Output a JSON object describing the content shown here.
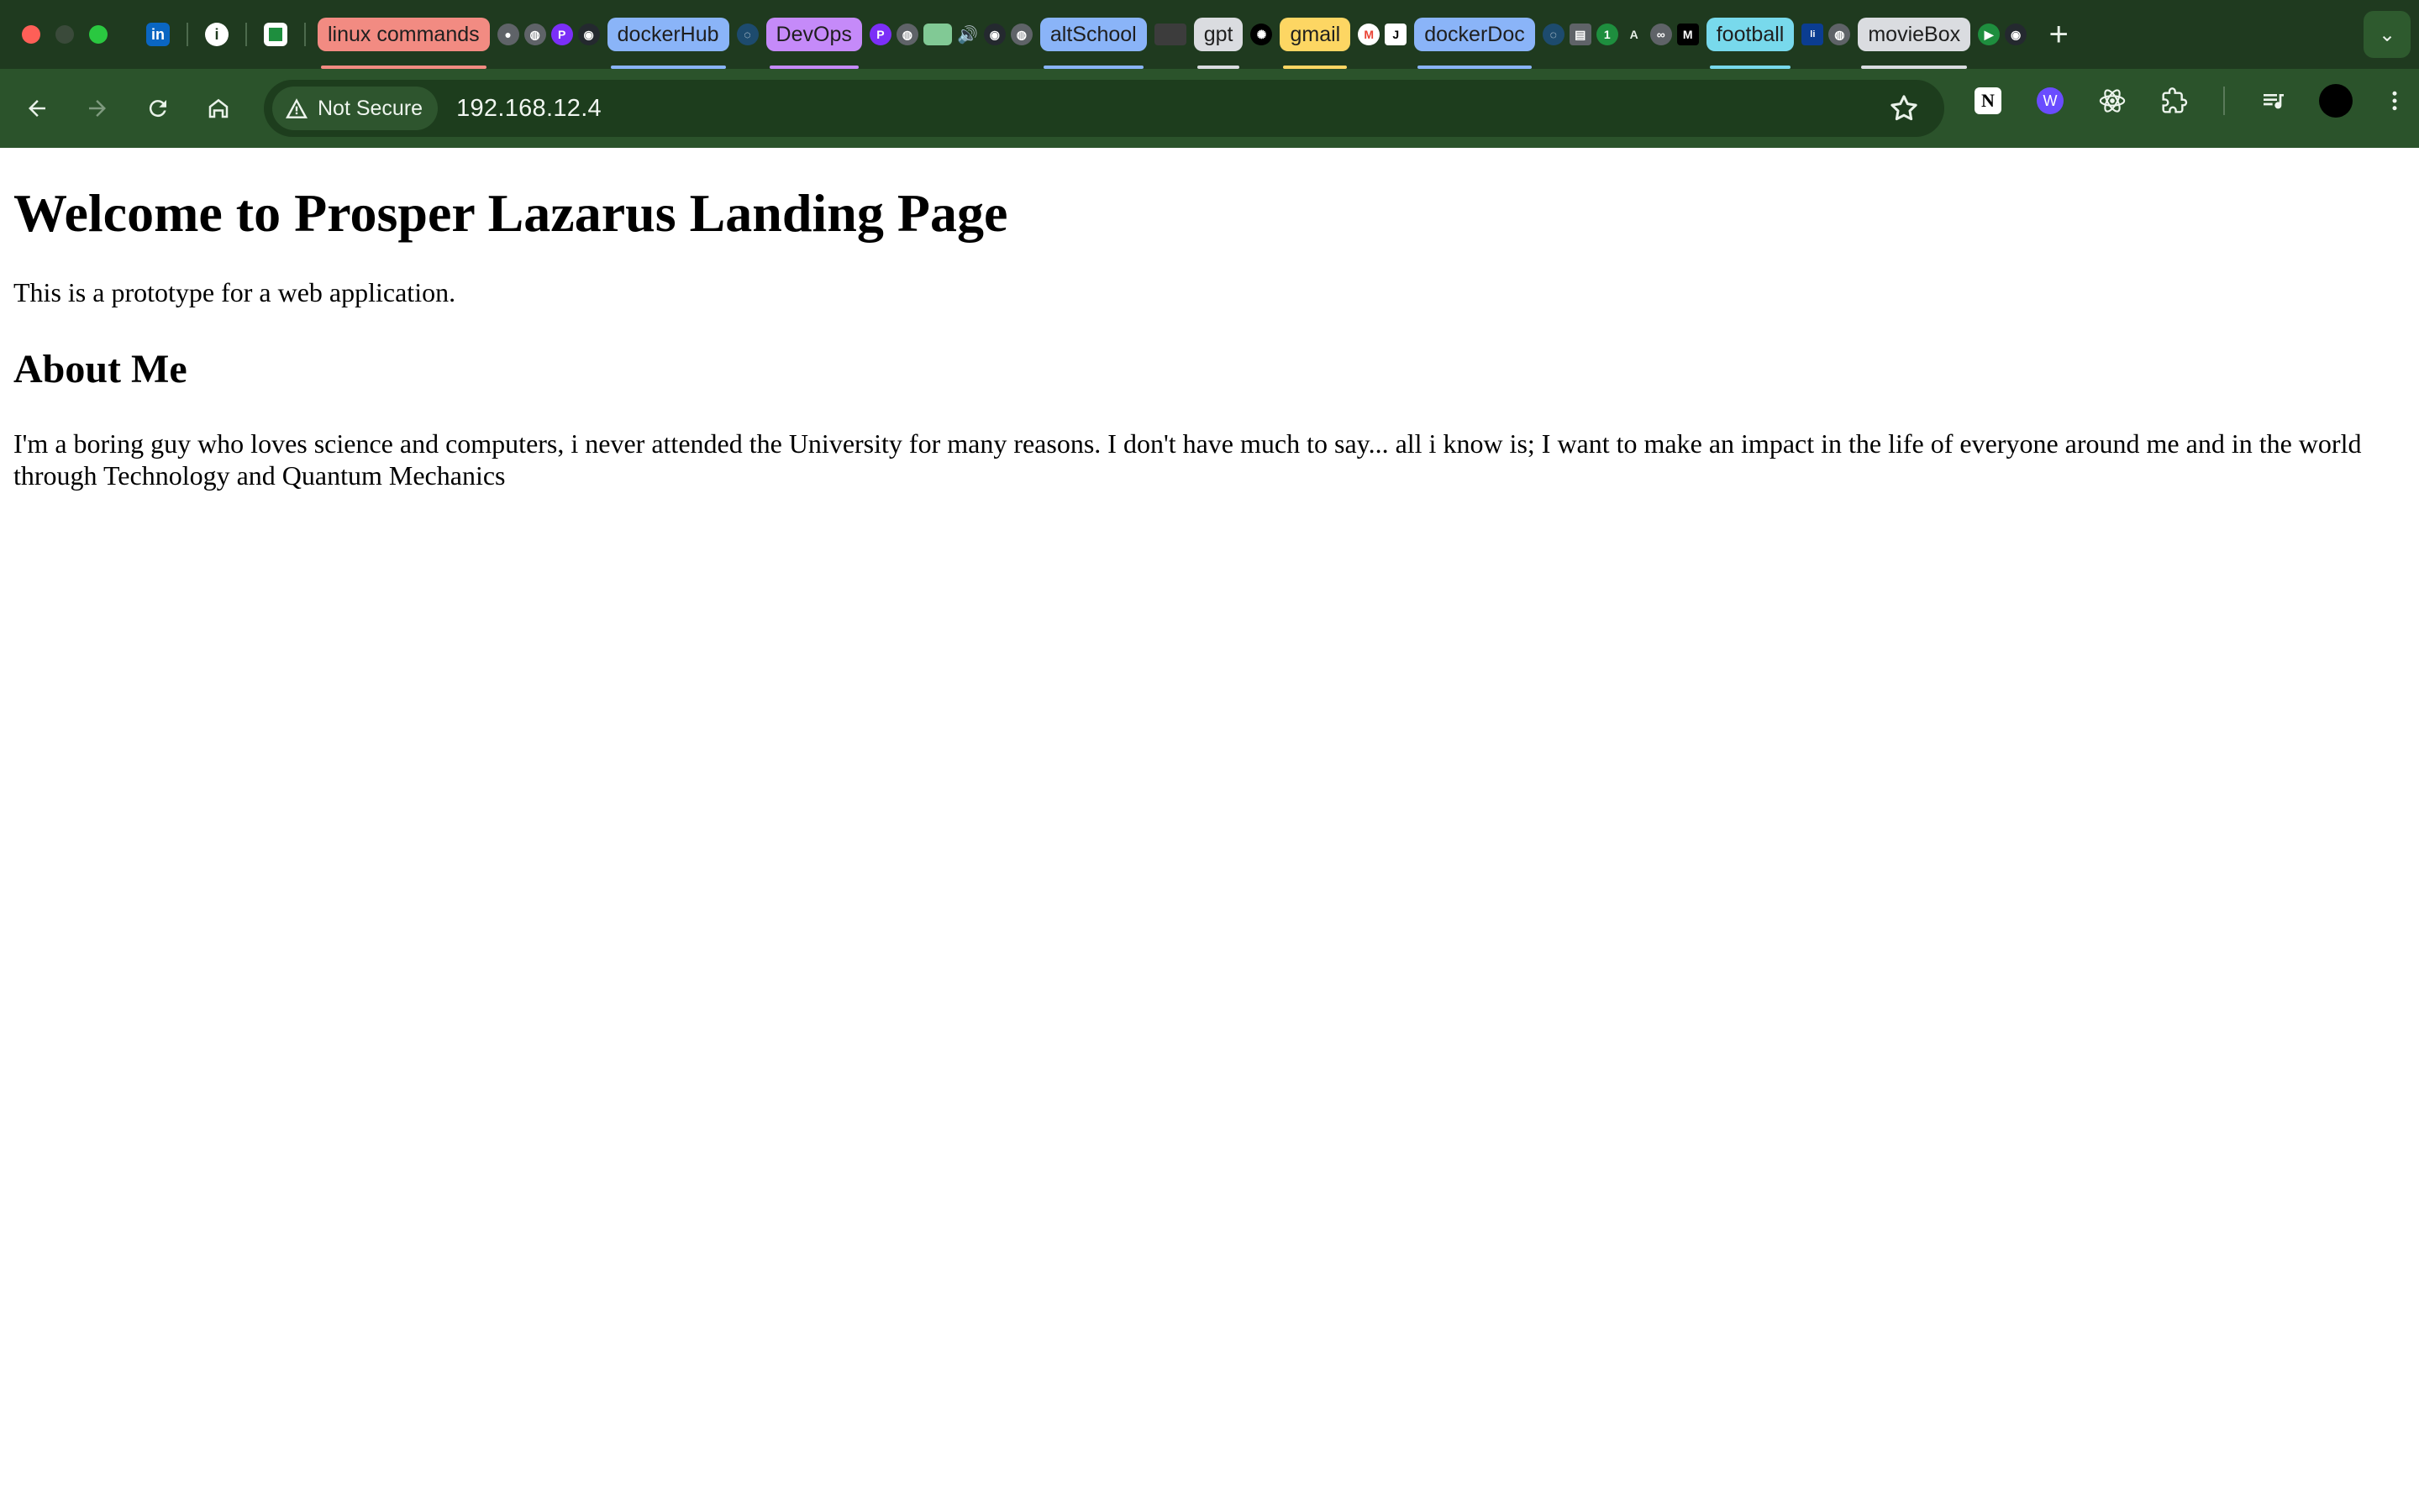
{
  "browser": {
    "tab_groups": [
      {
        "label": "linux commands",
        "chip_bg": "#f28b82",
        "text": "#1f1f1f",
        "line": "#f28b82"
      },
      {
        "label": "dockerHub",
        "chip_bg": "#8ab4f8",
        "text": "#1f1f1f",
        "line": "#8ab4f8"
      },
      {
        "label": "DevOps",
        "chip_bg": "#c58af9",
        "text": "#1f1f1f",
        "line": "#c58af9"
      },
      {
        "label": "altSchool",
        "chip_bg": "#8ab4f8",
        "text": "#1f1f1f",
        "line": "#8ab4f8"
      },
      {
        "label": "gpt",
        "chip_bg": "#dadce0",
        "text": "#1f1f1f",
        "line": "#dadce0"
      },
      {
        "label": "gmail",
        "chip_bg": "#fdd663",
        "text": "#1f1f1f",
        "line": "#fdd663"
      },
      {
        "label": "dockerDoc",
        "chip_bg": "#8ab4f8",
        "text": "#1f1f1f",
        "line": "#8ab4f8"
      },
      {
        "label": "football",
        "chip_bg": "#78d9ec",
        "text": "#1f1f1f",
        "line": "#78d9ec"
      },
      {
        "label": "movieBox",
        "chip_bg": "#dadce0",
        "text": "#1f1f1f",
        "line": "#dadce0"
      }
    ],
    "security_label": "Not Secure",
    "url": "192.168.12.4",
    "new_tab_symbol": "+",
    "tab_search_symbol": "⌄",
    "colors": {
      "tabstrip_bg": "#1f3a1f",
      "toolbar_bg": "#2b532b",
      "omnibox_bg": "#1d3d1d"
    },
    "icons": {
      "back": "arrow-left-icon",
      "forward": "arrow-right-icon",
      "reload": "reload-icon",
      "home": "home-icon",
      "bookmark": "star-icon",
      "notion": "notion-icon",
      "extension_w": "w-extension-icon",
      "react_devtools": "react-icon",
      "extensions": "puzzle-icon",
      "media": "media-control-icon",
      "profile": "profile-avatar-icon",
      "menu": "kebab-menu-icon"
    }
  },
  "page": {
    "heading": "Welcome to Prosper Lazarus Landing Page",
    "intro": "This is a prototype for a web application.",
    "about_heading": "About Me",
    "about_text": "I'm a boring guy who loves science and computers, i never attended the University for many reasons. I don't have much to say... all i know is; I want to make an impact in the life of everyone around me and in the world through Technology and Quantum Mechanics"
  }
}
